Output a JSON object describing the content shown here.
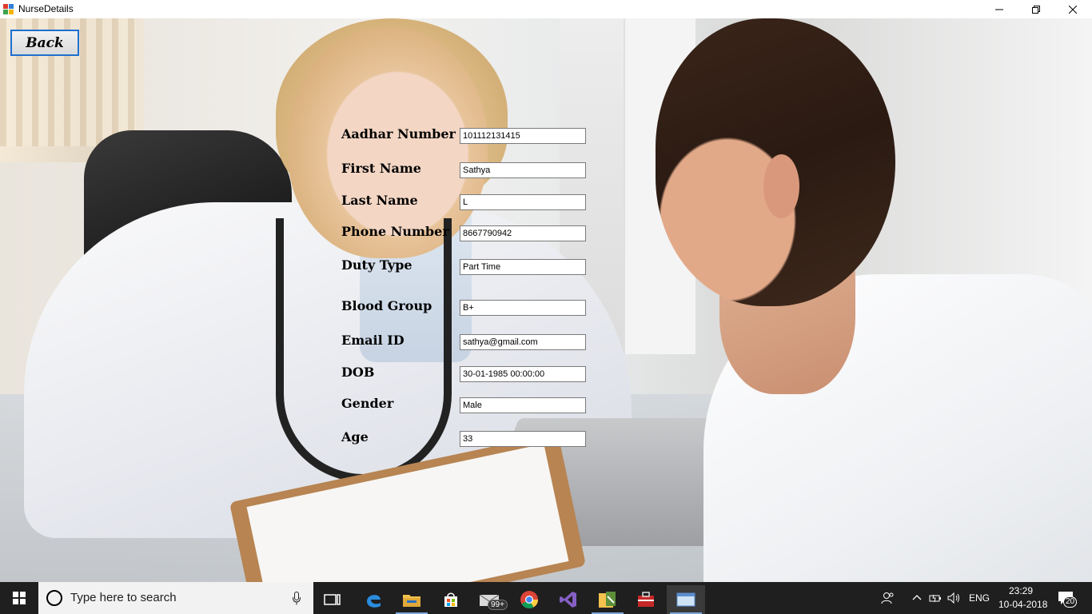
{
  "window": {
    "title": "NurseDetails",
    "minimize": "—",
    "maximize": "❐",
    "close": "✕"
  },
  "back_button": {
    "label": "Back"
  },
  "form": {
    "fields": [
      {
        "label": "Aadhar Number",
        "value": "101112131415"
      },
      {
        "label": "First Name",
        "value": "Sathya"
      },
      {
        "label": "Last Name",
        "value": "L"
      },
      {
        "label": "Phone Number",
        "value": "8667790942"
      },
      {
        "label": "Duty Type",
        "value": "Part Time"
      },
      {
        "label": "Blood Group",
        "value": "B+"
      },
      {
        "label": "Email ID",
        "value": "sathya@gmail.com"
      },
      {
        "label": "DOB",
        "value": "30-01-1985 00:00:00"
      },
      {
        "label": "Gender",
        "value": "Male"
      },
      {
        "label": "Age",
        "value": "33"
      }
    ]
  },
  "taskbar": {
    "search_placeholder": "Type here to search",
    "mail_badge": "99+",
    "language": "ENG",
    "time": "23:29",
    "date": "10-04-2018",
    "notification_count": "20",
    "pinned_apps": [
      "task-view",
      "edge",
      "file-explorer",
      "store",
      "mail",
      "chrome",
      "visual-studio",
      "settings-tool",
      "app-red",
      "window-app"
    ]
  },
  "colors": {
    "accent": "#1f6fd0",
    "taskbar": "#1f1f1f"
  }
}
